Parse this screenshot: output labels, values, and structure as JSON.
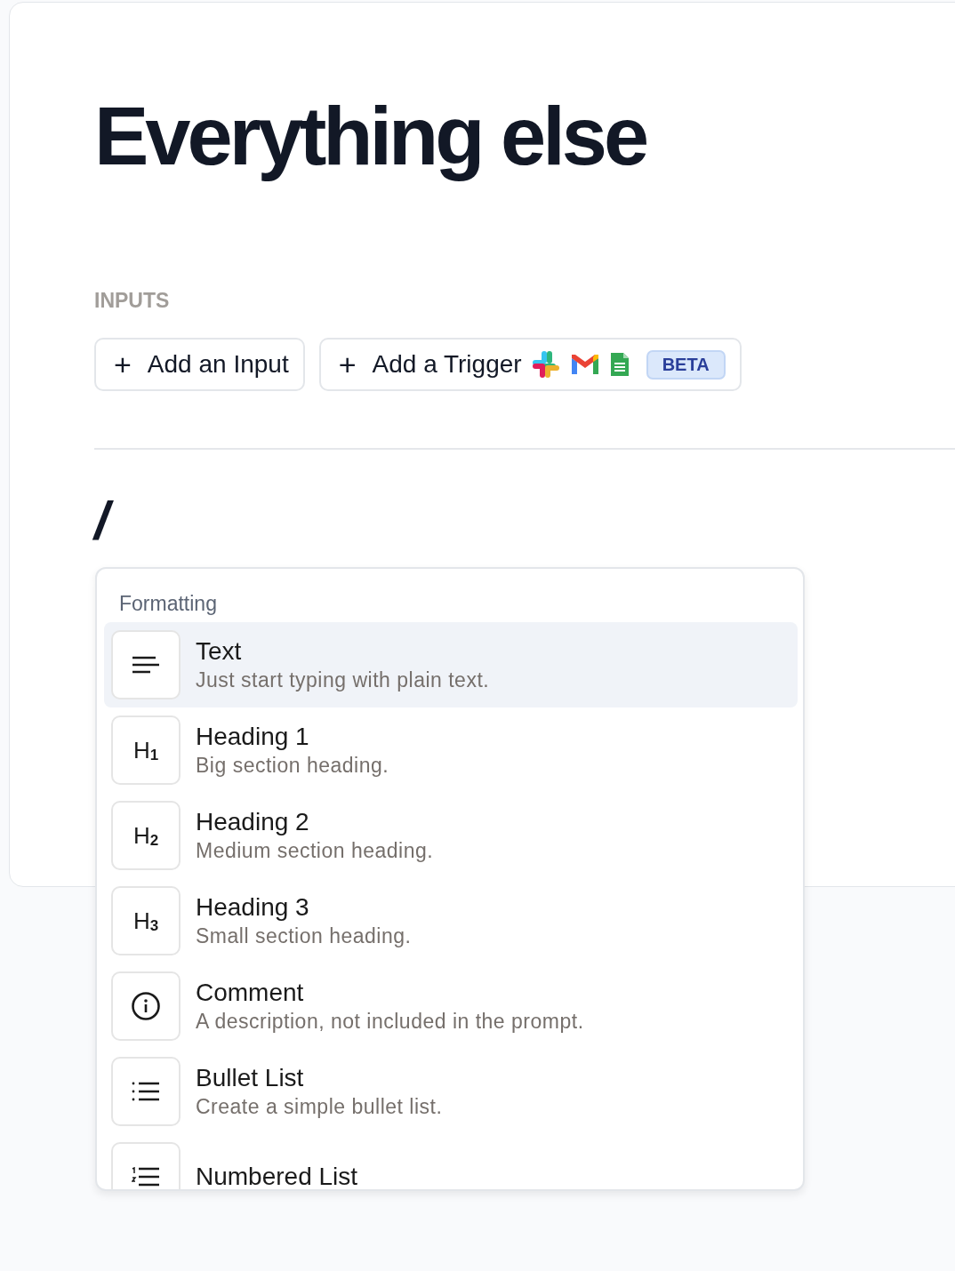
{
  "title": "Everything else",
  "inputs": {
    "label": "INPUTS",
    "buttons": [
      {
        "kind": "input",
        "icon": "+",
        "label": "Add an Input"
      },
      {
        "kind": "trigger",
        "icon": "+",
        "label": "Add a Trigger",
        "badge": "BETA"
      }
    ]
  },
  "editor": {
    "value": "/"
  },
  "menu": {
    "section": "Formatting",
    "items": [
      {
        "kind": "text",
        "title": "Text",
        "description": "Just start typing with plain text.",
        "selected": true
      },
      {
        "kind": "heading",
        "glyph": "H$_{1}$",
        "title": "Heading 1",
        "description": "Big section heading.",
        "selected": false
      },
      {
        "kind": "heading",
        "glyph": "H$_{2}$",
        "title": "Heading 2",
        "description": "Medium section heading.",
        "selected": false
      },
      {
        "kind": "heading",
        "glyph": "H$_{3}$",
        "title": "Heading 3",
        "description": "Small section heading.",
        "selected": false
      },
      {
        "kind": "comment",
        "title": "Comment",
        "description": "A description, not included in the prompt.",
        "selected": false
      },
      {
        "kind": "bullet",
        "title": "Bullet List",
        "description": "Create a simple bullet list.",
        "selected": false
      },
      {
        "kind": "numbered",
        "title": "Numbered List",
        "selected": false
      }
    ]
  }
}
